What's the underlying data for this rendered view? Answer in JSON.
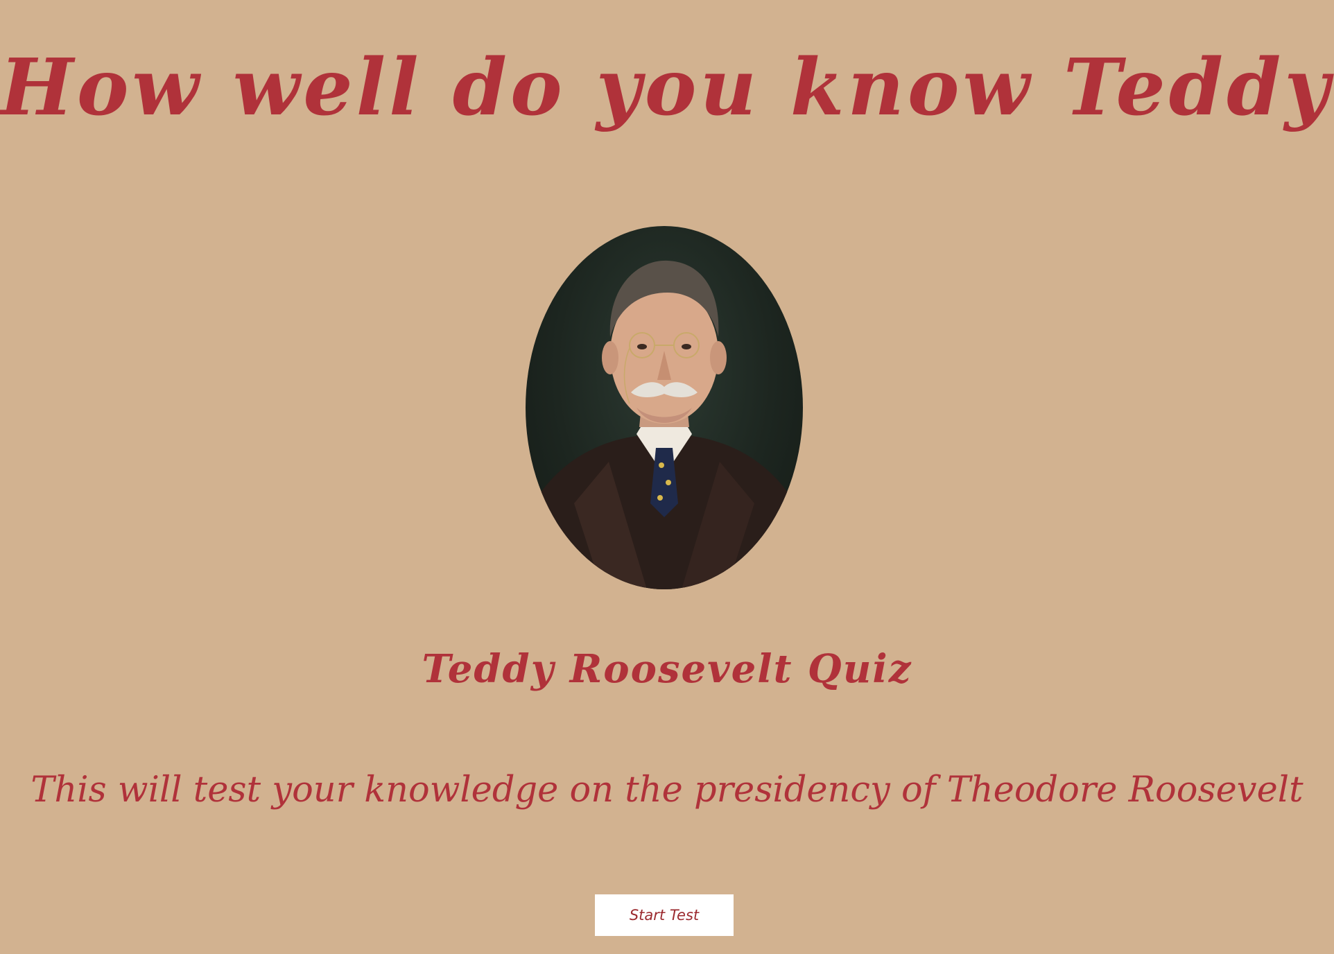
{
  "page": {
    "title": "How well do you know Teddy?",
    "quiz_name": "Teddy Roosevelt Quiz",
    "description": "This will test your knowledge on the presidency of Theodore Roosevelt",
    "start_button_label": "Start Test"
  },
  "portrait": {
    "icon": "portrait-image"
  },
  "colors": {
    "background": "#d2b290",
    "text_accent": "#b0323a",
    "button_background": "#ffffff",
    "button_text": "#9b2a2f"
  }
}
